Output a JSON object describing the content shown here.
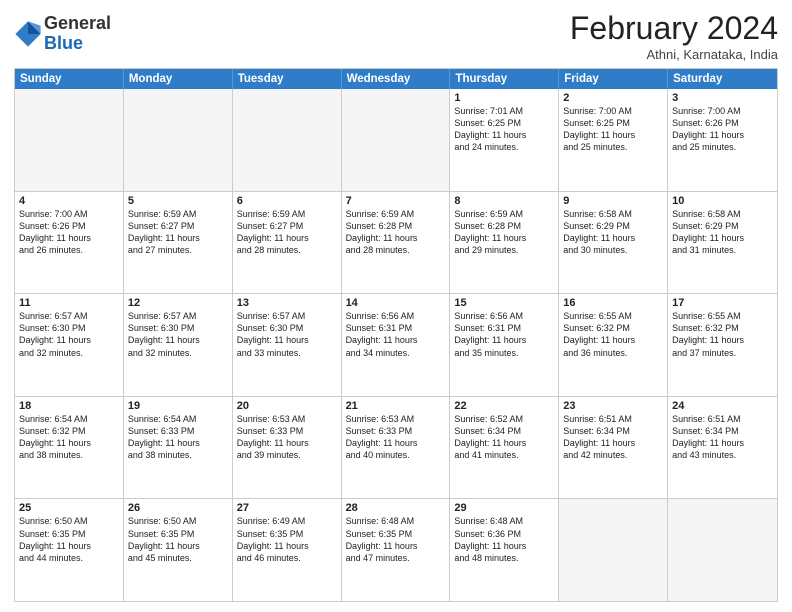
{
  "logo": {
    "general": "General",
    "blue": "Blue"
  },
  "title": "February 2024",
  "location": "Athni, Karnataka, India",
  "header_days": [
    "Sunday",
    "Monday",
    "Tuesday",
    "Wednesday",
    "Thursday",
    "Friday",
    "Saturday"
  ],
  "weeks": [
    [
      {
        "day": "",
        "empty": true,
        "info": ""
      },
      {
        "day": "",
        "empty": true,
        "info": ""
      },
      {
        "day": "",
        "empty": true,
        "info": ""
      },
      {
        "day": "",
        "empty": true,
        "info": ""
      },
      {
        "day": "1",
        "empty": false,
        "info": "Sunrise: 7:01 AM\nSunset: 6:25 PM\nDaylight: 11 hours\nand 24 minutes."
      },
      {
        "day": "2",
        "empty": false,
        "info": "Sunrise: 7:00 AM\nSunset: 6:25 PM\nDaylight: 11 hours\nand 25 minutes."
      },
      {
        "day": "3",
        "empty": false,
        "info": "Sunrise: 7:00 AM\nSunset: 6:26 PM\nDaylight: 11 hours\nand 25 minutes."
      }
    ],
    [
      {
        "day": "4",
        "empty": false,
        "info": "Sunrise: 7:00 AM\nSunset: 6:26 PM\nDaylight: 11 hours\nand 26 minutes."
      },
      {
        "day": "5",
        "empty": false,
        "info": "Sunrise: 6:59 AM\nSunset: 6:27 PM\nDaylight: 11 hours\nand 27 minutes."
      },
      {
        "day": "6",
        "empty": false,
        "info": "Sunrise: 6:59 AM\nSunset: 6:27 PM\nDaylight: 11 hours\nand 28 minutes."
      },
      {
        "day": "7",
        "empty": false,
        "info": "Sunrise: 6:59 AM\nSunset: 6:28 PM\nDaylight: 11 hours\nand 28 minutes."
      },
      {
        "day": "8",
        "empty": false,
        "info": "Sunrise: 6:59 AM\nSunset: 6:28 PM\nDaylight: 11 hours\nand 29 minutes."
      },
      {
        "day": "9",
        "empty": false,
        "info": "Sunrise: 6:58 AM\nSunset: 6:29 PM\nDaylight: 11 hours\nand 30 minutes."
      },
      {
        "day": "10",
        "empty": false,
        "info": "Sunrise: 6:58 AM\nSunset: 6:29 PM\nDaylight: 11 hours\nand 31 minutes."
      }
    ],
    [
      {
        "day": "11",
        "empty": false,
        "info": "Sunrise: 6:57 AM\nSunset: 6:30 PM\nDaylight: 11 hours\nand 32 minutes."
      },
      {
        "day": "12",
        "empty": false,
        "info": "Sunrise: 6:57 AM\nSunset: 6:30 PM\nDaylight: 11 hours\nand 32 minutes."
      },
      {
        "day": "13",
        "empty": false,
        "info": "Sunrise: 6:57 AM\nSunset: 6:30 PM\nDaylight: 11 hours\nand 33 minutes."
      },
      {
        "day": "14",
        "empty": false,
        "info": "Sunrise: 6:56 AM\nSunset: 6:31 PM\nDaylight: 11 hours\nand 34 minutes."
      },
      {
        "day": "15",
        "empty": false,
        "info": "Sunrise: 6:56 AM\nSunset: 6:31 PM\nDaylight: 11 hours\nand 35 minutes."
      },
      {
        "day": "16",
        "empty": false,
        "info": "Sunrise: 6:55 AM\nSunset: 6:32 PM\nDaylight: 11 hours\nand 36 minutes."
      },
      {
        "day": "17",
        "empty": false,
        "info": "Sunrise: 6:55 AM\nSunset: 6:32 PM\nDaylight: 11 hours\nand 37 minutes."
      }
    ],
    [
      {
        "day": "18",
        "empty": false,
        "info": "Sunrise: 6:54 AM\nSunset: 6:32 PM\nDaylight: 11 hours\nand 38 minutes."
      },
      {
        "day": "19",
        "empty": false,
        "info": "Sunrise: 6:54 AM\nSunset: 6:33 PM\nDaylight: 11 hours\nand 38 minutes."
      },
      {
        "day": "20",
        "empty": false,
        "info": "Sunrise: 6:53 AM\nSunset: 6:33 PM\nDaylight: 11 hours\nand 39 minutes."
      },
      {
        "day": "21",
        "empty": false,
        "info": "Sunrise: 6:53 AM\nSunset: 6:33 PM\nDaylight: 11 hours\nand 40 minutes."
      },
      {
        "day": "22",
        "empty": false,
        "info": "Sunrise: 6:52 AM\nSunset: 6:34 PM\nDaylight: 11 hours\nand 41 minutes."
      },
      {
        "day": "23",
        "empty": false,
        "info": "Sunrise: 6:51 AM\nSunset: 6:34 PM\nDaylight: 11 hours\nand 42 minutes."
      },
      {
        "day": "24",
        "empty": false,
        "info": "Sunrise: 6:51 AM\nSunset: 6:34 PM\nDaylight: 11 hours\nand 43 minutes."
      }
    ],
    [
      {
        "day": "25",
        "empty": false,
        "info": "Sunrise: 6:50 AM\nSunset: 6:35 PM\nDaylight: 11 hours\nand 44 minutes."
      },
      {
        "day": "26",
        "empty": false,
        "info": "Sunrise: 6:50 AM\nSunset: 6:35 PM\nDaylight: 11 hours\nand 45 minutes."
      },
      {
        "day": "27",
        "empty": false,
        "info": "Sunrise: 6:49 AM\nSunset: 6:35 PM\nDaylight: 11 hours\nand 46 minutes."
      },
      {
        "day": "28",
        "empty": false,
        "info": "Sunrise: 6:48 AM\nSunset: 6:35 PM\nDaylight: 11 hours\nand 47 minutes."
      },
      {
        "day": "29",
        "empty": false,
        "info": "Sunrise: 6:48 AM\nSunset: 6:36 PM\nDaylight: 11 hours\nand 48 minutes."
      },
      {
        "day": "",
        "empty": true,
        "info": ""
      },
      {
        "day": "",
        "empty": true,
        "info": ""
      }
    ]
  ]
}
